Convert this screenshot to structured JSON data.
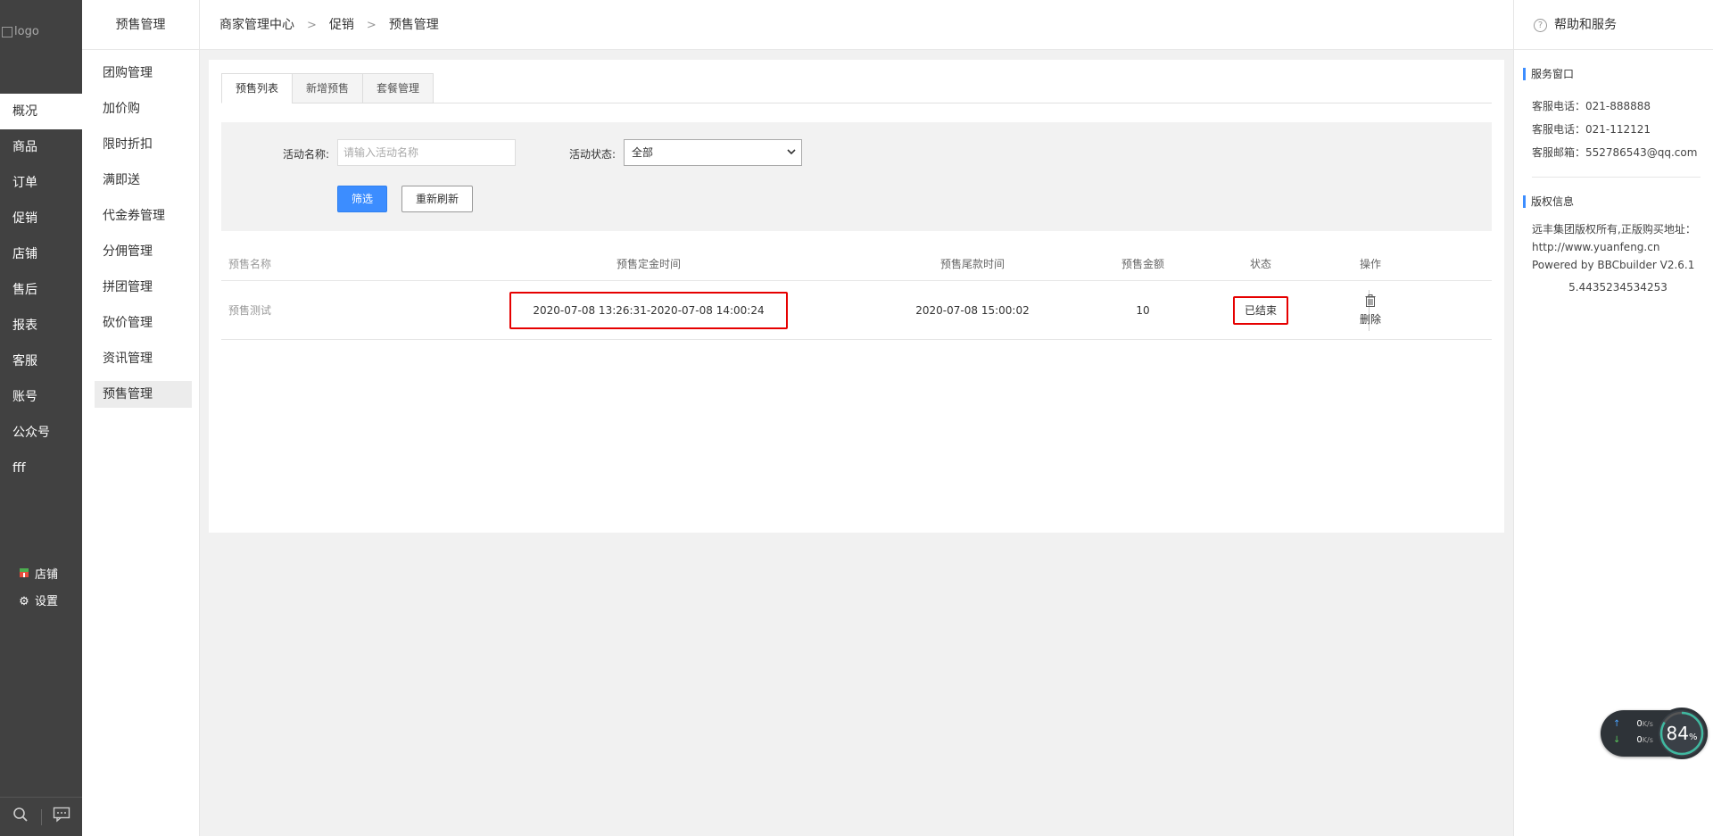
{
  "leftnav": {
    "logo_alt": "logo",
    "items": [
      {
        "label": "概况",
        "active": true
      },
      {
        "label": "商品"
      },
      {
        "label": "订单"
      },
      {
        "label": "促销"
      },
      {
        "label": "店铺"
      },
      {
        "label": "售后"
      },
      {
        "label": "报表"
      },
      {
        "label": "客服"
      },
      {
        "label": "账号"
      },
      {
        "label": "公众号"
      },
      {
        "label": "fff"
      }
    ],
    "shop_label": "店铺",
    "settings_label": "设置"
  },
  "subnav": {
    "title": "预售管理",
    "items": [
      {
        "label": "团购管理"
      },
      {
        "label": "加价购"
      },
      {
        "label": "限时折扣"
      },
      {
        "label": "满即送"
      },
      {
        "label": "代金券管理"
      },
      {
        "label": "分佣管理"
      },
      {
        "label": "拼团管理"
      },
      {
        "label": "砍价管理"
      },
      {
        "label": "资讯管理"
      },
      {
        "label": "预售管理",
        "active": true
      }
    ]
  },
  "breadcrumb": [
    "商家管理中心",
    "促销",
    "预售管理"
  ],
  "tabs": [
    {
      "label": "预售列表",
      "active": true
    },
    {
      "label": "新增预售"
    },
    {
      "label": "套餐管理"
    }
  ],
  "filter": {
    "name_label": "活动名称:",
    "name_placeholder": "请输入活动名称",
    "status_label": "活动状态:",
    "status_value": "全部",
    "filter_button": "筛选",
    "refresh_button": "重新刷新"
  },
  "table": {
    "headers": {
      "name": "预售名称",
      "deposit_time": "预售定金时间",
      "tail_time": "预售尾款时间",
      "amount": "预售金额",
      "status": "状态",
      "operation": "操作"
    },
    "rows": [
      {
        "name": "预售测试",
        "deposit_time": "2020-07-08 13:26:31-2020-07-08 14:00:24",
        "tail_time": "2020-07-08 15:00:02",
        "amount": "10",
        "status": "已结束",
        "delete_label": "删除"
      }
    ]
  },
  "help": {
    "title": "帮助和服务",
    "service_title": "服务窗口",
    "service_lines": [
      "客服电话：021-888888",
      "客服电话：021-112121",
      "客服邮箱：552786543@qq.com"
    ],
    "copyright_title": "版权信息",
    "copyright_text": "远丰集团版权所有,正版购买地址：http://www.yuanfeng.cn Powered by BBCbuilder V2.6.1",
    "version_number": "5.4435234534253"
  },
  "speed_widget": {
    "up": "0",
    "down": "0",
    "unit": "K/s",
    "percent": "84",
    "percent_sign": "%",
    "percent_value": 84
  },
  "colors": {
    "accent": "#3c8dff",
    "highlight": "#e60000",
    "sidebar_bg": "#414141"
  }
}
